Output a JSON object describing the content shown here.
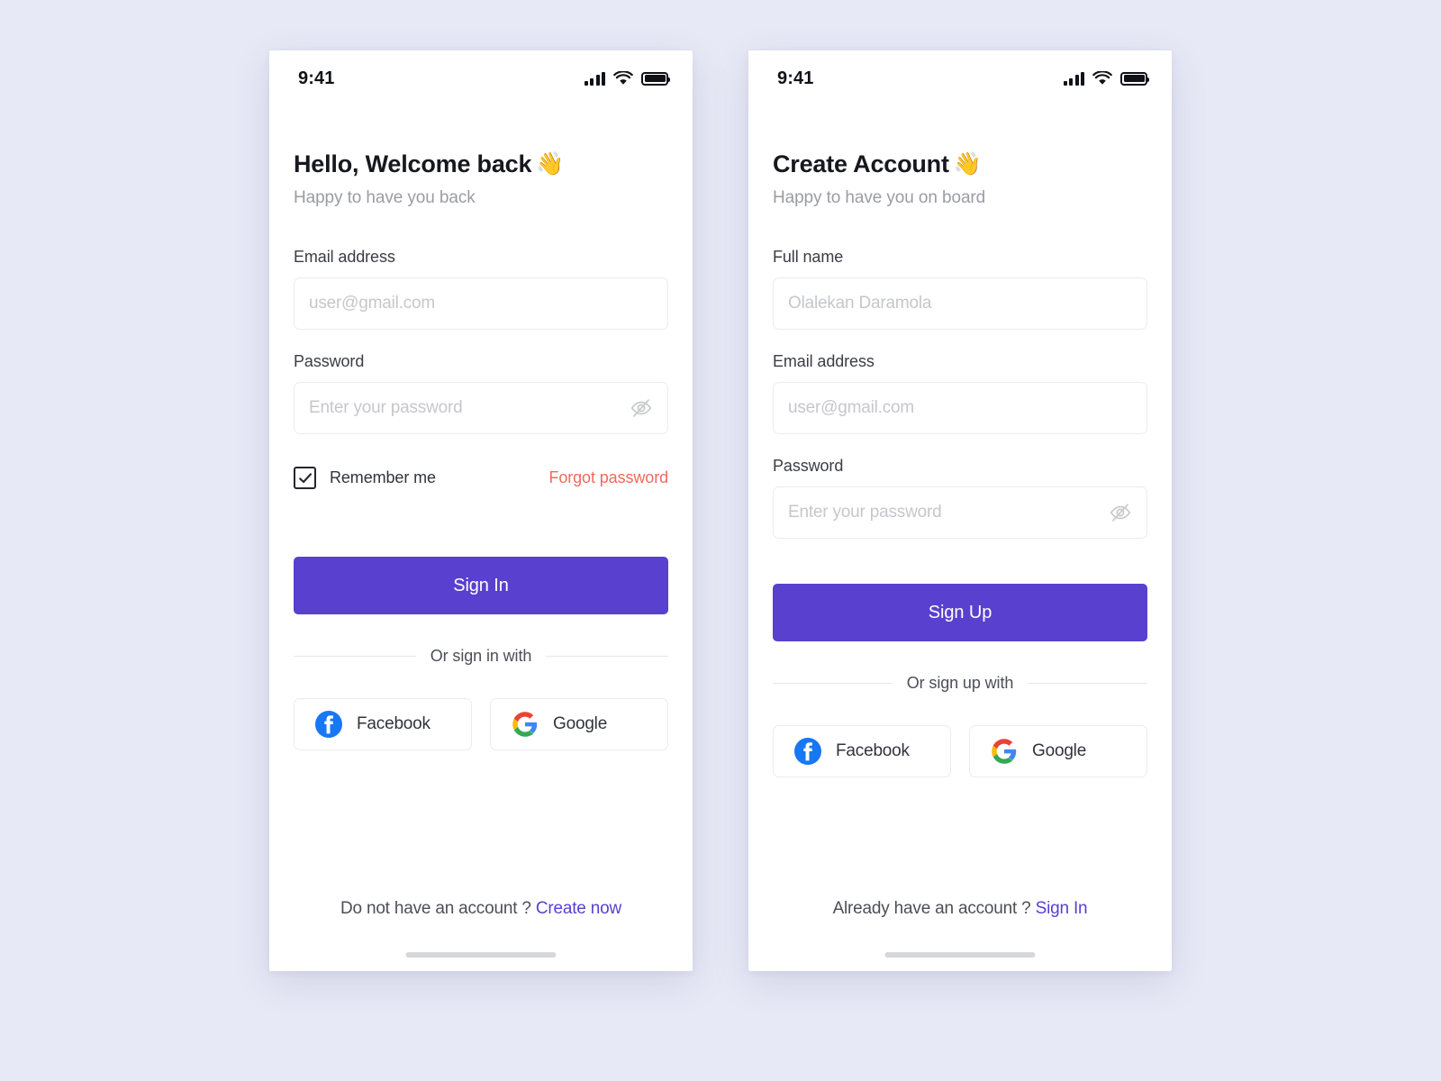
{
  "theme": {
    "page_background": "#e7e9f6",
    "primary": "#5940cf",
    "danger": "#f4685e",
    "text_dark": "#17181f",
    "text_muted": "#9b9ca4",
    "placeholder": "#c6c7cc",
    "border": "#ececee",
    "facebook_blue": "#1877f2"
  },
  "signin": {
    "status_bar": {
      "time": "9:41",
      "signal_icon": "signal-bars-icon",
      "wifi_icon": "wifi-icon",
      "battery_icon": "battery-full-icon"
    },
    "heading": "Hello, Welcome back",
    "heading_emoji": "👋",
    "subheading": "Happy to have you back",
    "fields": {
      "email": {
        "label": "Email address",
        "placeholder": "user@gmail.com",
        "value": ""
      },
      "password": {
        "label": "Password",
        "placeholder": "Enter your password",
        "value": "",
        "toggle_icon": "eye-off-icon"
      }
    },
    "remember": {
      "label": "Remember me",
      "checked": true,
      "check_icon": "check-icon"
    },
    "forgot_label": "Forgot password",
    "submit_label": "Sign In",
    "divider_label": "Or sign in with",
    "socials": [
      {
        "label": "Facebook",
        "icon": "facebook-icon"
      },
      {
        "label": "Google",
        "icon": "google-icon"
      }
    ],
    "footer": {
      "prompt": "Do not have an account ?",
      "link": "Create now"
    },
    "home_indicator": "home-indicator"
  },
  "signup": {
    "status_bar": {
      "time": "9:41",
      "signal_icon": "signal-bars-icon",
      "wifi_icon": "wifi-icon",
      "battery_icon": "battery-full-icon"
    },
    "heading": "Create Account",
    "heading_emoji": "👋",
    "subheading": "Happy to have you on board",
    "fields": {
      "fullname": {
        "label": "Full name",
        "placeholder": "Olalekan Daramola",
        "value": ""
      },
      "email": {
        "label": "Email address",
        "placeholder": "user@gmail.com",
        "value": ""
      },
      "password": {
        "label": "Password",
        "placeholder": "Enter your password",
        "value": "",
        "toggle_icon": "eye-off-icon"
      }
    },
    "submit_label": "Sign Up",
    "divider_label": "Or sign up with",
    "socials": [
      {
        "label": "Facebook",
        "icon": "facebook-icon"
      },
      {
        "label": "Google",
        "icon": "google-icon"
      }
    ],
    "footer": {
      "prompt": "Already have an account ?",
      "link": "Sign In"
    },
    "home_indicator": "home-indicator"
  }
}
